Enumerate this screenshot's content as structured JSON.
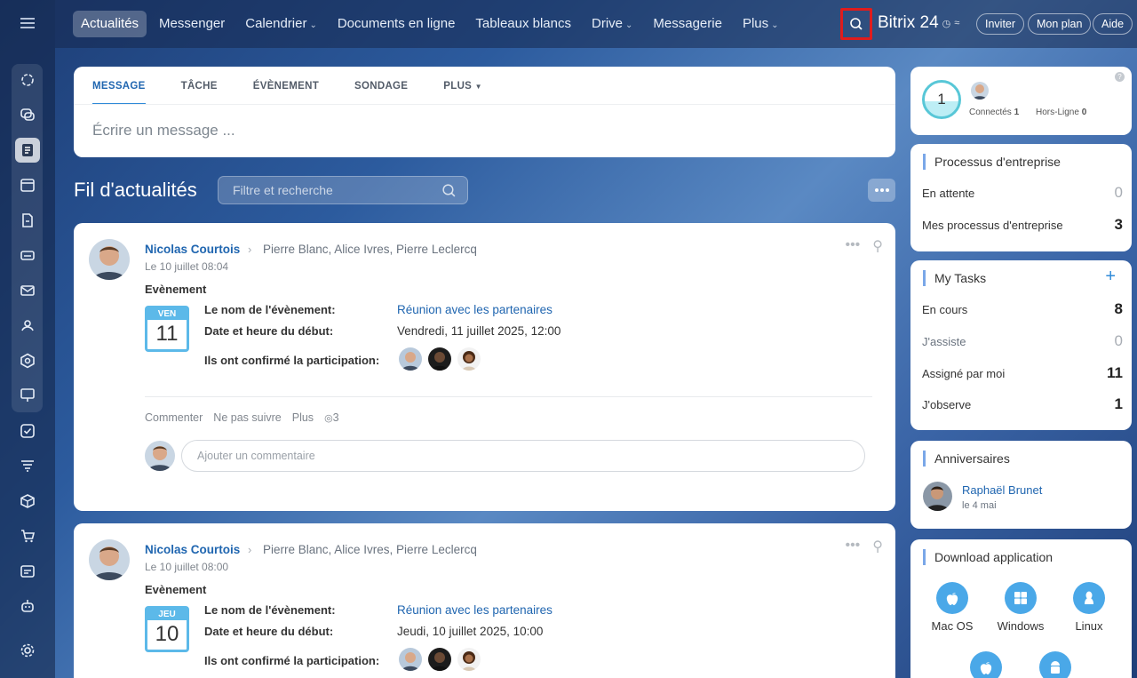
{
  "nav": {
    "items": [
      {
        "label": "Actualités",
        "active": true,
        "dropdown": false
      },
      {
        "label": "Messenger",
        "active": false,
        "dropdown": false
      },
      {
        "label": "Calendrier",
        "active": false,
        "dropdown": true
      },
      {
        "label": "Documents en ligne",
        "active": false,
        "dropdown": false
      },
      {
        "label": "Tableaux blancs",
        "active": false,
        "dropdown": false
      },
      {
        "label": "Drive",
        "active": false,
        "dropdown": true
      },
      {
        "label": "Messagerie",
        "active": false,
        "dropdown": false
      },
      {
        "label": "Plus",
        "active": false,
        "dropdown": true
      }
    ],
    "brand": "Bitrix 24",
    "invite": "Inviter",
    "plan": "Mon plan",
    "help": "Aide",
    "highlight_color": "#e01c1c"
  },
  "composer": {
    "tabs": [
      "MESSAGE",
      "TÂCHE",
      "ÉVÈNEMENT",
      "SONDAGE",
      "PLUS"
    ],
    "placeholder": "Écrire un message ..."
  },
  "feed": {
    "title": "Fil d'actualités",
    "filter_placeholder": "Filtre et recherche"
  },
  "posts": [
    {
      "author": "Nicolas Courtois",
      "recipients": "Pierre Blanc, Alice Ivres, Pierre Leclercq",
      "date": "Le 10 juillet 08:04",
      "type": "Evènement",
      "cal_day": "VEN",
      "cal_num": "11",
      "name_label": "Le nom de l'évènement:",
      "name_value": "Réunion avec les partenaires",
      "start_label": "Date et heure du début:",
      "start_value": "Vendredi, 11 juillet 2025, 12:00",
      "confirmed_label": "Ils ont confirmé la participation:",
      "actions": {
        "comment": "Commenter",
        "unfollow": "Ne pas suivre",
        "more": "Plus",
        "views": "3"
      },
      "comment_placeholder": "Ajouter un commentaire"
    },
    {
      "author": "Nicolas Courtois",
      "recipients": "Pierre Blanc, Alice Ivres, Pierre Leclercq",
      "date": "Le 10 juillet 08:00",
      "type": "Evènement",
      "cal_day": "JEU",
      "cal_num": "10",
      "name_label": "Le nom de l'évènement:",
      "name_value": "Réunion avec les partenaires",
      "start_label": "Date et heure du début:",
      "start_value": "Jeudi, 10 juillet 2025, 10:00",
      "confirmed_label": "Ils ont confirmé la participation:"
    }
  ],
  "online": {
    "count": "1",
    "connected_label": "Connectés",
    "connected": "1",
    "offline_label": "Hors-Ligne",
    "offline": "0"
  },
  "processes": {
    "title": "Processus d'entreprise",
    "rows": [
      {
        "label": "En attente",
        "value": "0"
      },
      {
        "label": "Mes processus d'entreprise",
        "value": "3"
      }
    ]
  },
  "tasks": {
    "title": "My Tasks",
    "rows": [
      {
        "label": "En cours",
        "value": "8"
      },
      {
        "label": "J'assiste",
        "value": "0"
      },
      {
        "label": "Assigné par moi",
        "value": "11"
      },
      {
        "label": "J'observe",
        "value": "1"
      }
    ]
  },
  "birthdays": {
    "title": "Anniversaires",
    "name": "Raphaël Brunet",
    "date": "le 4 mai"
  },
  "download": {
    "title": "Download application",
    "apps": [
      "Mac OS",
      "Windows",
      "Linux"
    ]
  }
}
